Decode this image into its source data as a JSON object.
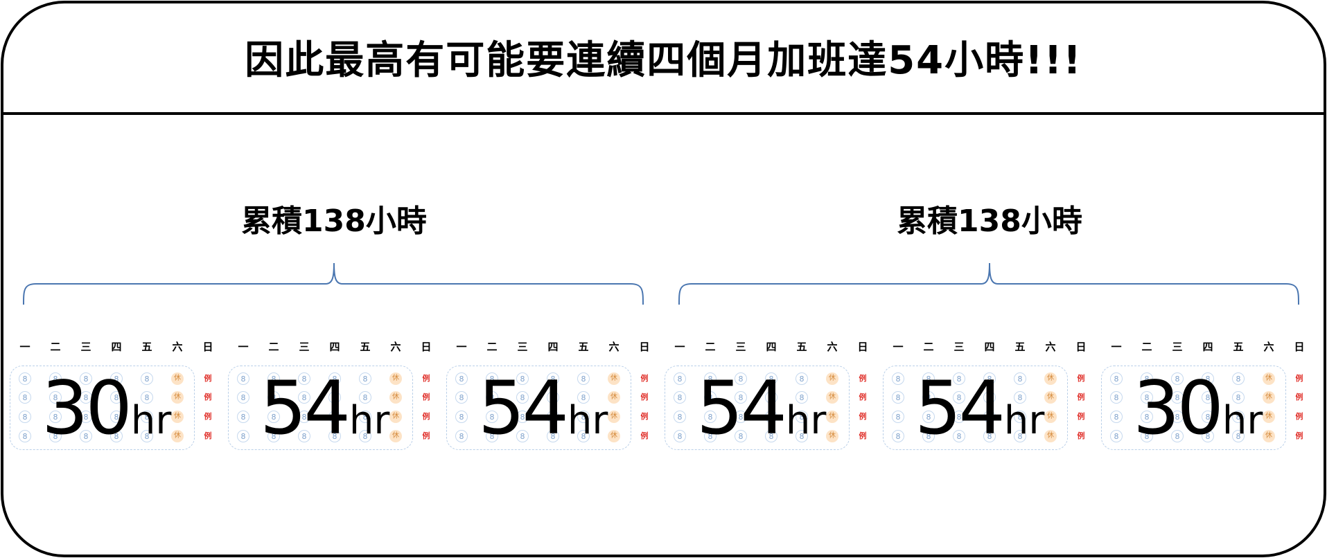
{
  "title": "因此最高有可能要連續四個月加班達54小時!!!",
  "groups": [
    {
      "label": "累積138小時"
    },
    {
      "label": "累積138小時"
    }
  ],
  "weekdays": [
    "一",
    "二",
    "三",
    "四",
    "五",
    "六",
    "日"
  ],
  "day_markers": {
    "work": "8",
    "rest": "休",
    "off": "例"
  },
  "months": [
    {
      "hours": "30",
      "unit": "hr"
    },
    {
      "hours": "54",
      "unit": "hr"
    },
    {
      "hours": "54",
      "unit": "hr"
    },
    {
      "hours": "54",
      "unit": "hr"
    },
    {
      "hours": "54",
      "unit": "hr"
    },
    {
      "hours": "30",
      "unit": "hr"
    }
  ],
  "colors": {
    "frame": "#000000",
    "brace": "#4a76b0",
    "work_dot": "#7fa2cc",
    "rest_dot": "#fde3c6",
    "off_text": "#e0302a",
    "month_border": "#b9cfe8"
  }
}
